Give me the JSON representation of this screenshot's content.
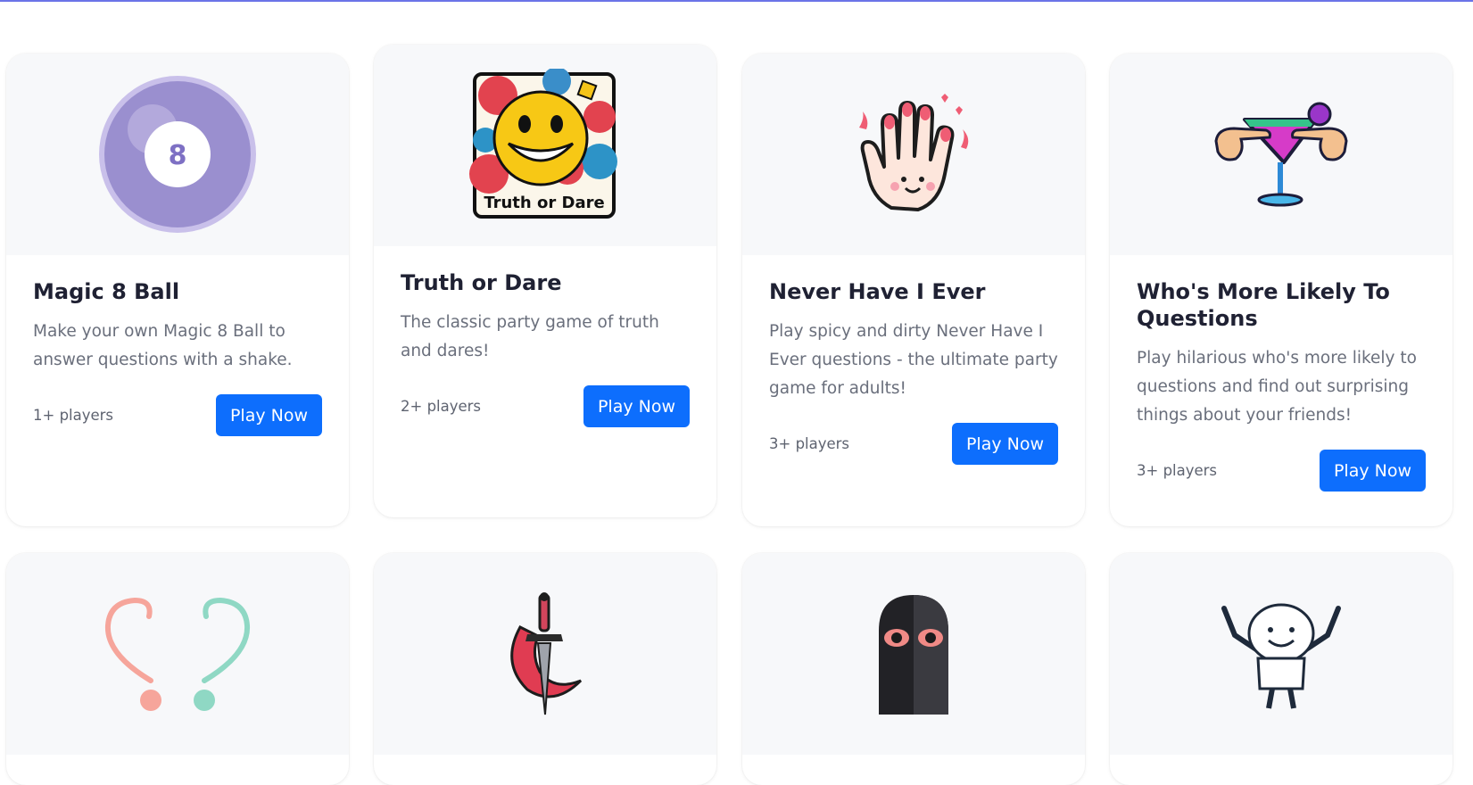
{
  "colors": {
    "accent": "#6b73e8",
    "button": "#0d6efd",
    "thumb_bg": "#f7f8fa",
    "title": "#1f2133",
    "text": "#6a6f7c"
  },
  "games": [
    {
      "title": "Magic 8 Ball",
      "description": "Make your own Magic 8 Ball to answer questions with a shake.",
      "players": "1+ players",
      "button": "Play Now",
      "icon": "magic-8-ball-icon",
      "ball_number": "8"
    },
    {
      "title": "Truth or Dare",
      "description": "The classic party game of truth and dares!",
      "players": "2+ players",
      "button": "Play Now",
      "icon": "truth-or-dare-icon",
      "image_caption": "Truth or Dare"
    },
    {
      "title": "Never Have I Ever",
      "description": "Play spicy and dirty Never Have I Ever questions - the ultimate party game for adults!",
      "players": "3+ players",
      "button": "Play Now",
      "icon": "hand-icon"
    },
    {
      "title": "Who's More Likely To Questions",
      "description": "Play hilarious who's more likely to questions and find out surprising things about your friends!",
      "players": "3+ players",
      "button": "Play Now",
      "icon": "cocktail-pointing-icon"
    }
  ],
  "games_row2": [
    {
      "icon": "question-marks-icon"
    },
    {
      "icon": "dagger-icon"
    },
    {
      "icon": "balaclava-icon"
    },
    {
      "icon": "smiling-figure-icon"
    }
  ]
}
